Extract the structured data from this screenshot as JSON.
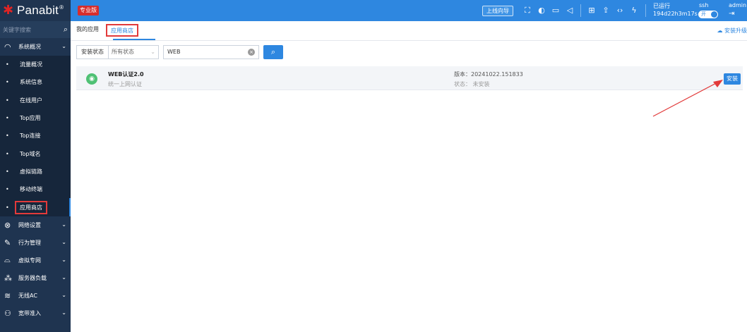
{
  "brand": {
    "name": "Panabit",
    "reg": "®"
  },
  "edition": "专业版",
  "header": {
    "wizard": "上线向导",
    "uptime_label": "已运行",
    "uptime_value": "194d22h3m17s",
    "ssh": "ssh",
    "ssh_toggle": "开",
    "user": "admin"
  },
  "sidebar": {
    "search_placeholder": "关键字搜索",
    "group1": "系统概况",
    "sub": [
      "流量概况",
      "系统信息",
      "在线用户",
      "Top应用",
      "Top连接",
      "Top域名",
      "虚拟链路",
      "移动终端",
      "应用商店"
    ],
    "groups": [
      "网络设置",
      "行为管理",
      "虚拟专网",
      "服务器负载",
      "无线AC",
      "宽带准入"
    ]
  },
  "tabs": {
    "my_apps": "我的应用",
    "store": "应用商店",
    "upgrade": "安装升级"
  },
  "filter": {
    "label": "安装状态",
    "status": "所有状态",
    "query": "WEB"
  },
  "app": {
    "name": "WEB认证2.0",
    "desc": "统一上网认证",
    "version": "版本：20241022.151833",
    "status": "状态： 未安装",
    "install": "安装"
  },
  "colors": {
    "accent": "#2e87e0",
    "sidebar": "#1f3450",
    "highlight": "#e23a3a"
  }
}
